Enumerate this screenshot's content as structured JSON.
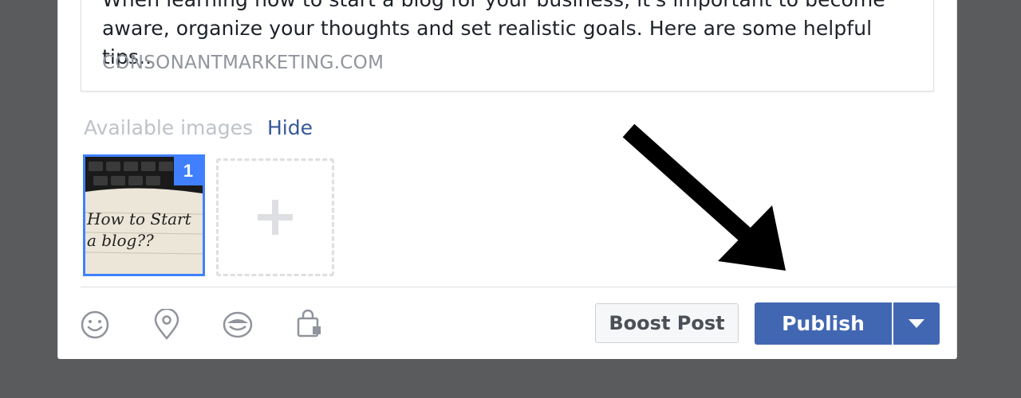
{
  "link_preview": {
    "description": "When learning how to start a blog for your business, it's important to become\naware, organize your thoughts and set realistic goals. Here are some helpful tips..",
    "domain": "CONSONANTMARKETING.COM"
  },
  "images": {
    "label": "Available images",
    "hide_label": "Hide",
    "selected_number": "1",
    "thumb_text_line1": "How to Start",
    "thumb_text_line2": "a blog??"
  },
  "toolbar": {
    "icons": [
      "smiley-icon",
      "location-pin-icon",
      "sticker-icon",
      "shopping-bag-icon"
    ]
  },
  "actions": {
    "boost_label": "Boost Post",
    "publish_label": "Publish"
  },
  "colors": {
    "accent": "#4267b2",
    "link": "#365899",
    "selection": "#4080ff",
    "backdrop": "#5a5b5d"
  }
}
